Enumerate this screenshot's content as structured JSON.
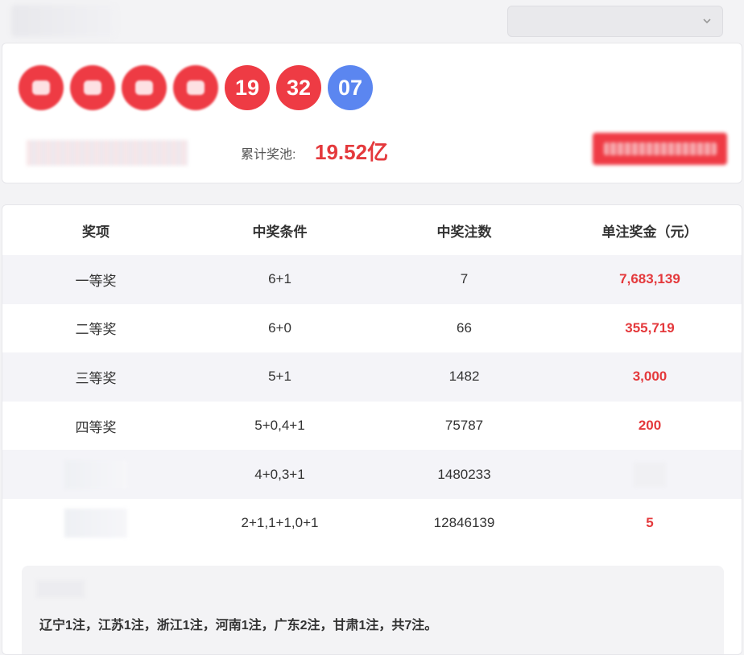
{
  "header": {
    "select_value": "",
    "icons": {
      "dropdown": "chevron-down-icon"
    }
  },
  "draw": {
    "balls": [
      {
        "number": "",
        "color": "red",
        "obscured": true
      },
      {
        "number": "",
        "color": "red",
        "obscured": true
      },
      {
        "number": "",
        "color": "red",
        "obscured": true
      },
      {
        "number": "",
        "color": "red",
        "obscured": true
      },
      {
        "number": "19",
        "color": "red",
        "obscured": false
      },
      {
        "number": "32",
        "color": "red",
        "obscured": false
      },
      {
        "number": "07",
        "color": "blue",
        "obscured": false
      }
    ],
    "pool_label": "累计奖池:",
    "pool_value": "19.52亿",
    "colors": {
      "red": "#ee3b44",
      "blue": "#5b86f0",
      "prize_text": "#e4393c"
    }
  },
  "table": {
    "headers": [
      "奖项",
      "中奖条件",
      "中奖注数",
      "单注奖金（元）"
    ],
    "rows": [
      {
        "level": "一等奖",
        "condition": "6+1",
        "count": "7",
        "prize": "7,683,139"
      },
      {
        "level": "二等奖",
        "condition": "6+0",
        "count": "66",
        "prize": "355,719"
      },
      {
        "level": "三等奖",
        "condition": "5+1",
        "count": "1482",
        "prize": "3,000"
      },
      {
        "level": "四等奖",
        "condition": "5+0,4+1",
        "count": "75787",
        "prize": "200"
      },
      {
        "level": "",
        "condition": "4+0,3+1",
        "count": "1480233",
        "prize": ""
      },
      {
        "level": "",
        "condition": "2+1,1+1,0+1",
        "count": "12846139",
        "prize": "5"
      }
    ]
  },
  "note": {
    "text": "辽宁1注，江苏1注，浙江1注，河南1注，广东2注，甘肃1注，共7注。"
  }
}
